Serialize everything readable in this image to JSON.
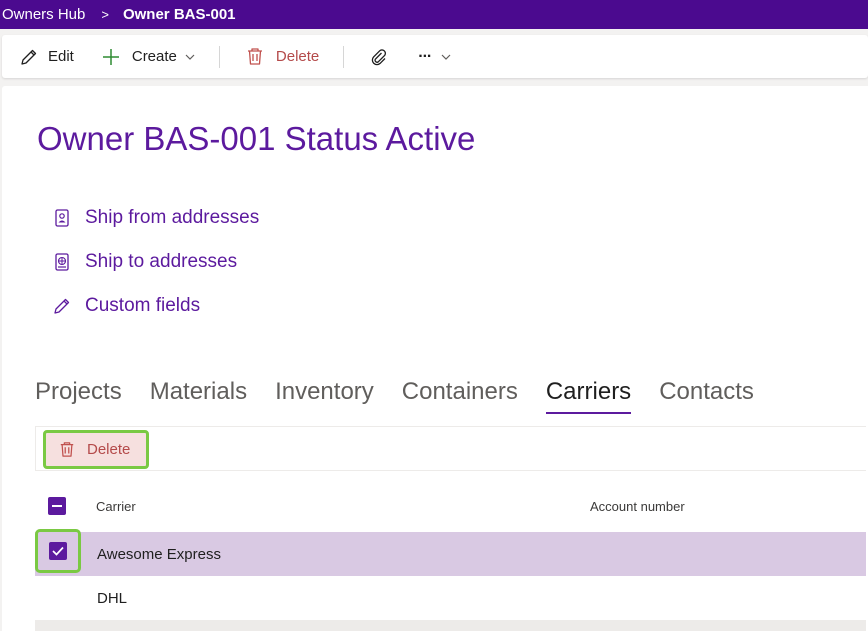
{
  "breadcrumb": {
    "parent": "Owners Hub",
    "separator": ">",
    "current": "Owner BAS-001"
  },
  "toolbar": {
    "edit_label": "Edit",
    "create_label": "Create",
    "delete_label": "Delete",
    "more_label": "···"
  },
  "page": {
    "title": "Owner BAS-001 Status Active"
  },
  "links": [
    {
      "label": "Ship from addresses",
      "icon": "contact-card-icon"
    },
    {
      "label": "Ship to addresses",
      "icon": "globe-card-icon"
    },
    {
      "label": "Custom fields",
      "icon": "pencil-icon"
    }
  ],
  "tabs": [
    {
      "label": "Projects",
      "active": false
    },
    {
      "label": "Materials",
      "active": false
    },
    {
      "label": "Inventory",
      "active": false
    },
    {
      "label": "Containers",
      "active": false
    },
    {
      "label": "Carriers",
      "active": true
    },
    {
      "label": "Contacts",
      "active": false
    }
  ],
  "grid": {
    "delete_label": "Delete",
    "columns": [
      "Carrier",
      "Account number"
    ],
    "rows": [
      {
        "carrier": "Awesome Express",
        "account_number": "",
        "selected": true
      },
      {
        "carrier": "DHL",
        "account_number": "",
        "selected": false
      }
    ]
  },
  "colors": {
    "brand": "#4b0a8f",
    "accent": "#5c1a9e",
    "highlight": "#7ac943",
    "danger": "#a4262c",
    "selected_row": "#d9c9e3"
  }
}
